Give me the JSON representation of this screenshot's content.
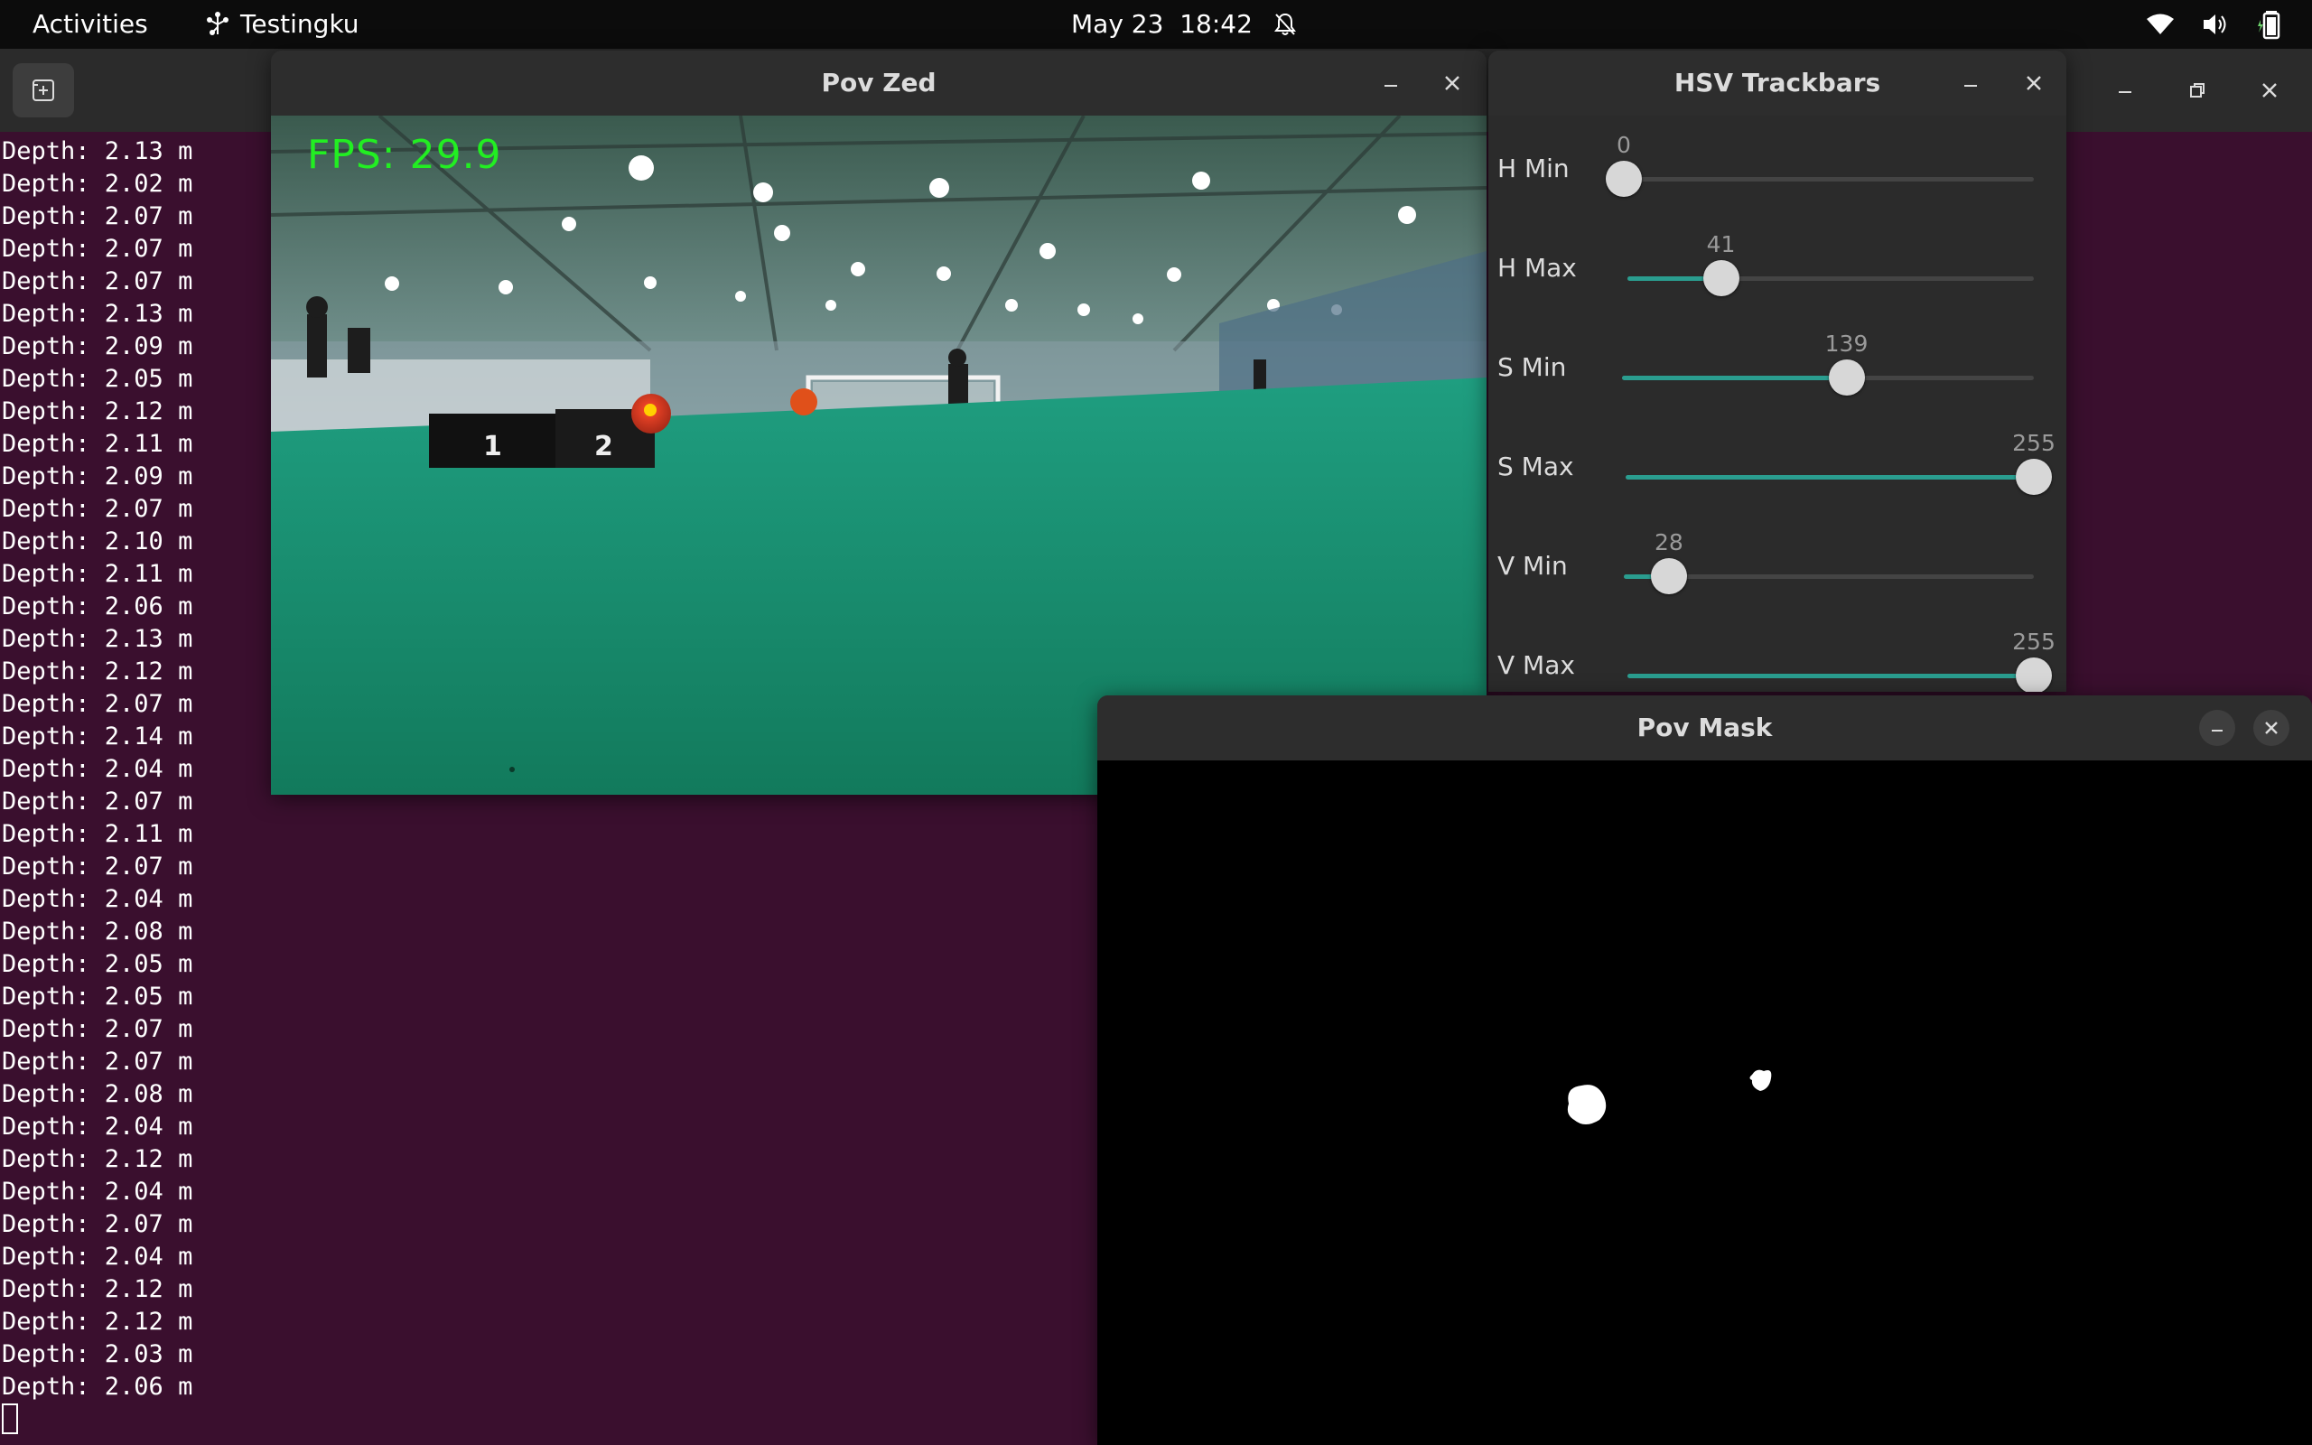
{
  "topbar": {
    "activities": "Activities",
    "app_name": "Testingku",
    "clock": "May 23  18:42",
    "icons": [
      "notifications-muted-icon",
      "wifi-icon",
      "volume-icon",
      "battery-icon"
    ]
  },
  "terminal": {
    "lines": [
      "Depth: 2.13 m",
      "Depth: 2.02 m",
      "Depth: 2.07 m",
      "Depth: 2.07 m",
      "Depth: 2.07 m",
      "Depth: 2.13 m",
      "Depth: 2.09 m",
      "Depth: 2.05 m",
      "Depth: 2.12 m",
      "Depth: 2.11 m",
      "Depth: 2.09 m",
      "Depth: 2.07 m",
      "Depth: 2.10 m",
      "Depth: 2.11 m",
      "Depth: 2.06 m",
      "Depth: 2.13 m",
      "Depth: 2.12 m",
      "Depth: 2.07 m",
      "Depth: 2.14 m",
      "Depth: 2.04 m",
      "Depth: 2.07 m",
      "Depth: 2.11 m",
      "Depth: 2.07 m",
      "Depth: 2.04 m",
      "Depth: 2.08 m",
      "Depth: 2.05 m",
      "Depth: 2.05 m",
      "Depth: 2.07 m",
      "Depth: 2.07 m",
      "Depth: 2.08 m",
      "Depth: 2.04 m",
      "Depth: 2.12 m",
      "Depth: 2.04 m",
      "Depth: 2.07 m",
      "Depth: 2.04 m",
      "Depth: 2.12 m",
      "Depth: 2.12 m",
      "Depth: 2.03 m",
      "Depth: 2.06 m"
    ],
    "background_color": "#3a0f2e"
  },
  "pov_zed": {
    "title": "Pov Zed",
    "fps_text": "FPS: 29.9",
    "box_labels": [
      "1",
      "2"
    ],
    "fps_color": "#22ee22"
  },
  "hsv_trackbars": {
    "title": "HSV Trackbars",
    "accent_color": "#2a9d8f",
    "sliders": [
      {
        "label": "H Min",
        "value": "0",
        "fraction": 0.0
      },
      {
        "label": "H Max",
        "value": "41",
        "fraction": 0.23
      },
      {
        "label": "S Min",
        "value": "139",
        "fraction": 0.545
      },
      {
        "label": "S Max",
        "value": "255",
        "fraction": 1.0
      },
      {
        "label": "V Min",
        "value": "28",
        "fraction": 0.11
      },
      {
        "label": "V Max",
        "value": "255",
        "fraction": 1.0
      }
    ]
  },
  "pov_mask": {
    "title": "Pov Mask"
  }
}
